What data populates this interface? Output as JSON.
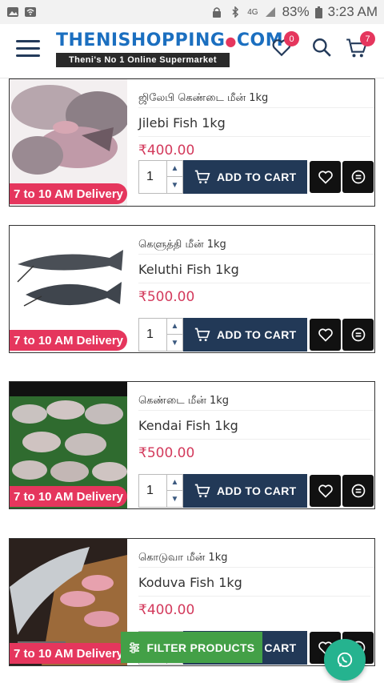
{
  "status_bar": {
    "network": "4G",
    "battery": "83%",
    "time": "3:23 AM"
  },
  "header": {
    "logo_text": "THENISHOPPING",
    "logo_suffix": "COM",
    "tagline": "Theni's No 1 Online Supermarket",
    "wishlist_count": "0",
    "cart_count": "7",
    "menu_icon": "hamburger-icon",
    "wishlist_icon": "heart-icon",
    "search_icon": "search-icon",
    "cart_icon": "cart-icon"
  },
  "products": [
    {
      "tamil_name": "ஜிலேபி கெண்டை மீன் 1kg",
      "name": "Jilebi Fish 1kg",
      "price": "₹400.00",
      "delivery": "7 to 10 AM Delivery",
      "qty": "1",
      "add_to_cart": "ADD TO CART"
    },
    {
      "tamil_name": "கெளுத்தி மீன் 1kg",
      "name": "Keluthi Fish 1kg",
      "price": "₹500.00",
      "delivery": "7 to 10 AM Delivery",
      "qty": "1",
      "add_to_cart": "ADD TO CART"
    },
    {
      "tamil_name": "கெண்டை மீன் 1kg",
      "name": "Kendai Fish 1kg",
      "price": "₹500.00",
      "delivery": "7 to 10 AM Delivery",
      "qty": "1",
      "add_to_cart": "ADD TO CART"
    },
    {
      "tamil_name": "கொடுவா மீன் 1kg",
      "name": "Koduva Fish 1kg",
      "price": "₹400.00",
      "delivery": "7 to 10 AM Delivery",
      "qty": "1",
      "add_to_cart": "ADD TO CART"
    }
  ],
  "filter_button": "FILTER PRODUCTS",
  "colors": {
    "brand_blue": "#1b6fc0",
    "accent_pink": "#e5365d",
    "navy": "#223957",
    "price_red": "#d33a5c",
    "filter_green": "#43a047",
    "whatsapp_green": "#25b38f"
  }
}
